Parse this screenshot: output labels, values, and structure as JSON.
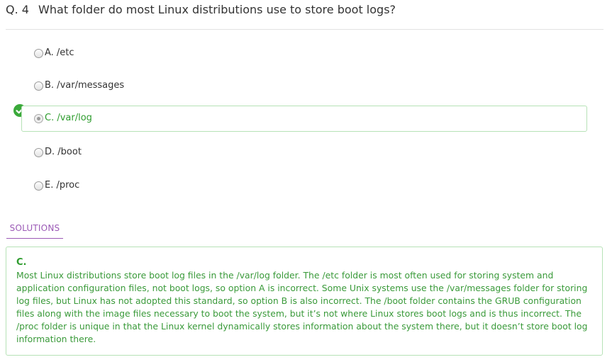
{
  "question": {
    "number": "Q. 4",
    "text": "What folder do most Linux distributions use to store boot logs?"
  },
  "options": [
    {
      "label": "A. /etc",
      "correct": false
    },
    {
      "label": "B. /var/messages",
      "correct": false
    },
    {
      "label": "C. /var/log",
      "correct": true
    },
    {
      "label": "D. /boot",
      "correct": false
    },
    {
      "label": "E. /proc",
      "correct": false
    }
  ],
  "solutions_tab": "SOLUTIONS",
  "solution": {
    "answer": "C.",
    "explanation": "Most Linux distributions store boot log files in the /var/log folder. The /etc folder is most often used for storing system and application configuration files, not boot logs, so option A is incorrect. Some Unix systems use the /var/messages folder for storing log files, but Linux has not adopted this standard, so option B is also incorrect. The /boot folder contains the GRUB configuration files along with the image files necessary to boot the system, but it’s not where Linux stores boot logs and is thus incorrect. The /proc folder is unique in that the Linux kernel dynamically stores information about the system there, but it doesn’t store boot log information there."
  },
  "colors": {
    "correct_green": "#2e9c2e",
    "correct_border": "#b6e2b6",
    "accent_purple": "#9b59b6"
  },
  "icons": {
    "correct_marker": "check-circle-icon",
    "option_control": "radio-button"
  }
}
